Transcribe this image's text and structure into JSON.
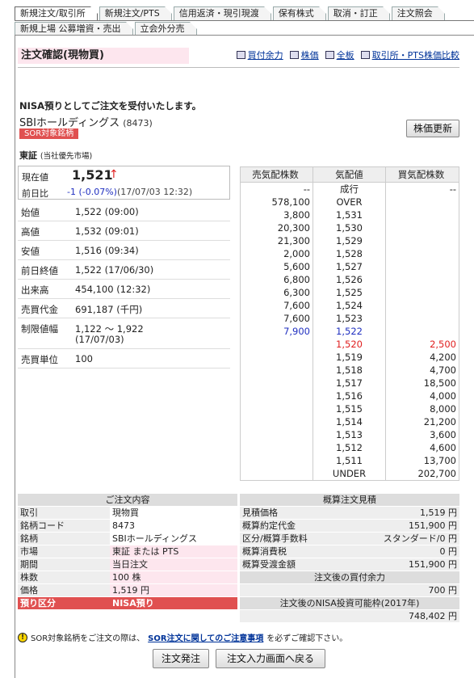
{
  "tabs_row1": [
    "新規注文/取引所",
    "新規注文/PTS",
    "信用返済・現引現渡",
    "保有株式",
    "取消・訂正",
    "注文照会"
  ],
  "tabs_row2": [
    "新規上場 公募増資・売出",
    "立会外分売"
  ],
  "header": {
    "title": "注文確認(現物買)",
    "links": [
      "買付余力",
      "株価",
      "全板",
      "取引所・PTS株価比較"
    ]
  },
  "message": "NISA預りとしてご注文を受付いたします。",
  "stock": {
    "name": "SBIホールディングス",
    "code": "(8473)",
    "badge": "SOR対象銘柄",
    "update_button": "株価更新"
  },
  "market": {
    "name": "東証",
    "note": "(当社優先市場)"
  },
  "price": {
    "label_now": "現在値",
    "now": "1,521",
    "arrow": "↑",
    "label_prev": "前日比",
    "change": "-1 (-0.07%)",
    "time": "(17/07/03 12:32)"
  },
  "info": [
    {
      "k": "始値",
      "v": "1,522 (09:00)"
    },
    {
      "k": "高値",
      "v": "1,532 (09:01)"
    },
    {
      "k": "安値",
      "v": "1,516 (09:34)"
    },
    {
      "k": "前日終値",
      "v": "1,522 (17/06/30)"
    },
    {
      "k": "出来高",
      "v": "454,100 (12:32)"
    },
    {
      "k": "売買代金",
      "v": "691,187 (千円)"
    },
    {
      "k": "制限値幅",
      "v": "1,122 ～ 1,922",
      "v2": "(17/07/03)"
    },
    {
      "k": "売買単位",
      "v": "100"
    }
  ],
  "book": {
    "headers": [
      "売気配株数",
      "気配値",
      "買気配株数"
    ],
    "rows": [
      [
        "--",
        "成行",
        "--"
      ],
      [
        "578,100",
        "OVER",
        ""
      ],
      [
        "3,800",
        "1,531",
        ""
      ],
      [
        "20,300",
        "1,530",
        ""
      ],
      [
        "21,300",
        "1,529",
        ""
      ],
      [
        "2,000",
        "1,528",
        ""
      ],
      [
        "5,600",
        "1,527",
        ""
      ],
      [
        "6,800",
        "1,526",
        ""
      ],
      [
        "6,300",
        "1,525",
        ""
      ],
      [
        "7,600",
        "1,524",
        ""
      ],
      [
        "7,600",
        "1,523",
        ""
      ],
      [
        "7,900",
        "1,522",
        ""
      ],
      [
        "",
        "1,520",
        "2,500"
      ],
      [
        "",
        "1,519",
        "4,200"
      ],
      [
        "",
        "1,518",
        "4,700"
      ],
      [
        "",
        "1,517",
        "18,500"
      ],
      [
        "",
        "1,516",
        "4,000"
      ],
      [
        "",
        "1,515",
        "8,000"
      ],
      [
        "",
        "1,514",
        "21,200"
      ],
      [
        "",
        "1,513",
        "3,600"
      ],
      [
        "",
        "1,512",
        "4,600"
      ],
      [
        "",
        "1,511",
        "13,700"
      ],
      [
        "",
        "UNDER",
        "202,700"
      ]
    ]
  },
  "order": {
    "title": "ご注文内容",
    "rows": [
      {
        "k": "取引",
        "v": "現物買"
      },
      {
        "k": "銘柄コード",
        "v": "8473"
      },
      {
        "k": "銘柄",
        "v": "SBIホールディングス"
      },
      {
        "k": "市場",
        "v": "東証 または PTS"
      },
      {
        "k": "期間",
        "v": "当日注文"
      },
      {
        "k": "株数",
        "v": "100 株"
      },
      {
        "k": "価格",
        "v": "1,519 円"
      },
      {
        "k": "預り区分",
        "v": "NISA預り"
      }
    ]
  },
  "estimate": {
    "title": "概算注文見積",
    "rows": [
      {
        "k": "見積価格",
        "v": "1,519 円"
      },
      {
        "k": "概算約定代金",
        "v": "151,900 円"
      },
      {
        "k": "区分/概算手数料",
        "v": "スタンダード/0 円"
      },
      {
        "k": "概算消費税",
        "v": "0 円"
      },
      {
        "k": "概算受渡金額",
        "v": "151,900 円"
      }
    ],
    "buying_power_title": "注文後の買付余力",
    "buying_power": "700 円",
    "nisa_title": "注文後のNISA投資可能枠(2017年)",
    "nisa": "748,402 円"
  },
  "note": {
    "pre": "SOR対象銘柄をご注文の際は、",
    "link": "SOR注文に関してのご注意事項",
    "post": "を必ずご確認下さい。"
  },
  "buttons": {
    "submit": "注文発注",
    "back": "注文入力画面へ戻る"
  }
}
